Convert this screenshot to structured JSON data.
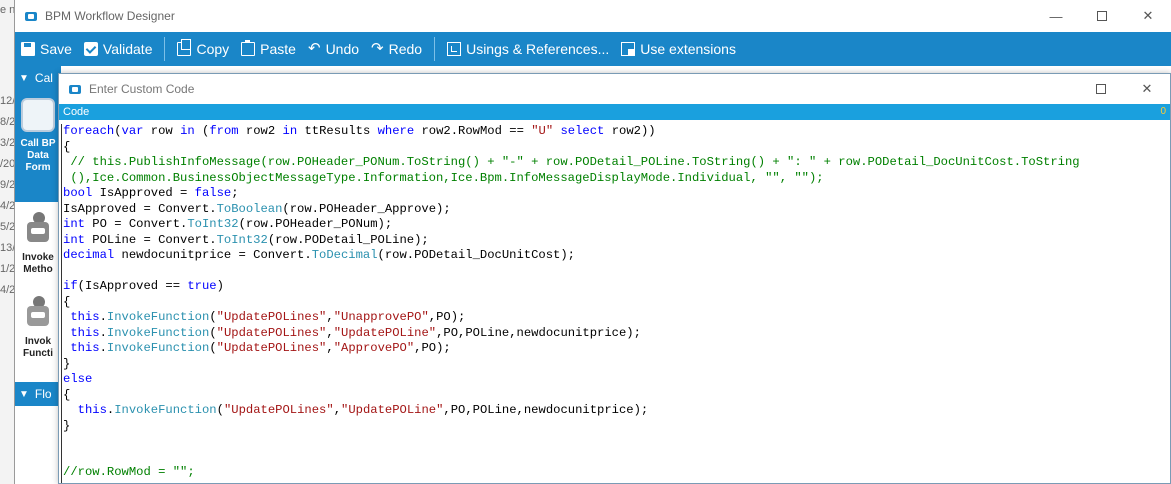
{
  "background": {
    "fragments": [
      "e n",
      "12/",
      "8/2",
      "3/2",
      "/20",
      "9/2",
      "4/2",
      "5/2",
      "13/",
      "1/2",
      "4/2"
    ]
  },
  "window": {
    "title": "BPM Workflow Designer",
    "minimize": "—",
    "maximize": "☐",
    "close": "✕"
  },
  "toolbar": {
    "items": [
      {
        "label": "Save",
        "icon": "save-icon"
      },
      {
        "label": "Validate",
        "icon": "validate-icon"
      },
      {
        "label": "Copy",
        "icon": "copy-icon"
      },
      {
        "label": "Paste",
        "icon": "paste-icon"
      },
      {
        "label": "Undo",
        "icon": "undo-icon"
      },
      {
        "label": "Redo",
        "icon": "redo-icon"
      },
      {
        "label": "Usings & References...",
        "icon": "usings-icon"
      },
      {
        "label": "Use extensions",
        "icon": "extensions-icon"
      }
    ],
    "undo_glyph": "↶",
    "redo_glyph": "↷"
  },
  "left_panel": {
    "section1": "Cal",
    "selected_tool": [
      "Call BP",
      "Data",
      "Form"
    ],
    "tool2": [
      "Invoke",
      "Metho"
    ],
    "tool3": [
      "Invok",
      "Functi"
    ],
    "section2": "Flo",
    "fx": "fx"
  },
  "dialog": {
    "title": "Enter Custom Code",
    "tab": "Code",
    "tab_marker": "0",
    "maximize": "☐",
    "close": "✕",
    "lines": [
      [
        [
          "kw",
          "foreach"
        ],
        [
          "",
          "("
        ],
        [
          "kw",
          "var"
        ],
        [
          "",
          " row "
        ],
        [
          "kw",
          "in"
        ],
        [
          "",
          " ("
        ],
        [
          "kw",
          "from"
        ],
        [
          "",
          " row2 "
        ],
        [
          "kw",
          "in"
        ],
        [
          "",
          " ttResults "
        ],
        [
          "kw",
          "where"
        ],
        [
          "",
          " row2.RowMod == "
        ],
        [
          "str",
          "\"U\""
        ],
        [
          "",
          " "
        ],
        [
          "kw",
          "select"
        ],
        [
          "",
          " row2))"
        ]
      ],
      [
        [
          "",
          "{"
        ]
      ],
      [
        [
          "cm",
          " // this.PublishInfoMessage(row.POHeader_PONum.ToString() + \"-\" + row.PODetail_POLine.ToString() + \": \" + row.PODetail_DocUnitCost.ToString"
        ]
      ],
      [
        [
          "cm",
          " (),Ice.Common.BusinessObjectMessageType.Information,Ice.Bpm.InfoMessageDisplayMode.Individual, \"\", \"\");"
        ]
      ],
      [
        [
          "kw",
          "bool"
        ],
        [
          "",
          " IsApproved = "
        ],
        [
          "kw",
          "false"
        ],
        [
          "",
          ";"
        ]
      ],
      [
        [
          "",
          "IsApproved = Convert."
        ],
        [
          "fn",
          "ToBoolean"
        ],
        [
          "",
          "(row.POHeader_Approve);"
        ]
      ],
      [
        [
          "kw",
          "int"
        ],
        [
          "",
          " PO = Convert."
        ],
        [
          "fn",
          "ToInt32"
        ],
        [
          "",
          "(row.POHeader_PONum);"
        ]
      ],
      [
        [
          "kw",
          "int"
        ],
        [
          "",
          " POLine = Convert."
        ],
        [
          "fn",
          "ToInt32"
        ],
        [
          "",
          "(row.PODetail_POLine);"
        ]
      ],
      [
        [
          "kw",
          "decimal"
        ],
        [
          "",
          " newdocunitprice = Convert."
        ],
        [
          "fn",
          "ToDecimal"
        ],
        [
          "",
          "(row.PODetail_DocUnitCost);"
        ]
      ],
      [
        [
          "",
          ""
        ]
      ],
      [
        [
          "kw",
          "if"
        ],
        [
          "",
          "(IsApproved == "
        ],
        [
          "kw",
          "true"
        ],
        [
          "",
          ")"
        ]
      ],
      [
        [
          "",
          "{"
        ]
      ],
      [
        [
          "",
          " "
        ],
        [
          "kw",
          "this"
        ],
        [
          "",
          "."
        ],
        [
          "fn",
          "InvokeFunction"
        ],
        [
          "",
          "("
        ],
        [
          "str",
          "\"UpdatePOLines\""
        ],
        [
          "",
          ","
        ],
        [
          "str",
          "\"UnapprovePO\""
        ],
        [
          "",
          ",PO);"
        ]
      ],
      [
        [
          "",
          " "
        ],
        [
          "kw",
          "this"
        ],
        [
          "",
          "."
        ],
        [
          "fn",
          "InvokeFunction"
        ],
        [
          "",
          "("
        ],
        [
          "str",
          "\"UpdatePOLines\""
        ],
        [
          "",
          ","
        ],
        [
          "str",
          "\"UpdatePOLine\""
        ],
        [
          "",
          ",PO,POLine,newdocunitprice);"
        ]
      ],
      [
        [
          "",
          " "
        ],
        [
          "kw",
          "this"
        ],
        [
          "",
          "."
        ],
        [
          "fn",
          "InvokeFunction"
        ],
        [
          "",
          "("
        ],
        [
          "str",
          "\"UpdatePOLines\""
        ],
        [
          "",
          ","
        ],
        [
          "str",
          "\"ApprovePO\""
        ],
        [
          "",
          ",PO);"
        ]
      ],
      [
        [
          "",
          "}"
        ]
      ],
      [
        [
          "kw",
          "else"
        ]
      ],
      [
        [
          "",
          "{"
        ]
      ],
      [
        [
          "",
          "  "
        ],
        [
          "kw",
          "this"
        ],
        [
          "",
          "."
        ],
        [
          "fn",
          "InvokeFunction"
        ],
        [
          "",
          "("
        ],
        [
          "str",
          "\"UpdatePOLines\""
        ],
        [
          "",
          ","
        ],
        [
          "str",
          "\"UpdatePOLine\""
        ],
        [
          "",
          ",PO,POLine,newdocunitprice);"
        ]
      ],
      [
        [
          "",
          "}"
        ]
      ],
      [
        [
          "",
          ""
        ]
      ],
      [
        [
          "",
          ""
        ]
      ],
      [
        [
          "cm",
          "//row.RowMod = \"\";"
        ]
      ]
    ]
  },
  "colors": {
    "toolbar_blue": "#1a86c8",
    "code_bar_blue": "#1aa0de",
    "keyword": "#0000ff",
    "string": "#a31515",
    "function": "#2b91af",
    "comment": "#008000"
  }
}
